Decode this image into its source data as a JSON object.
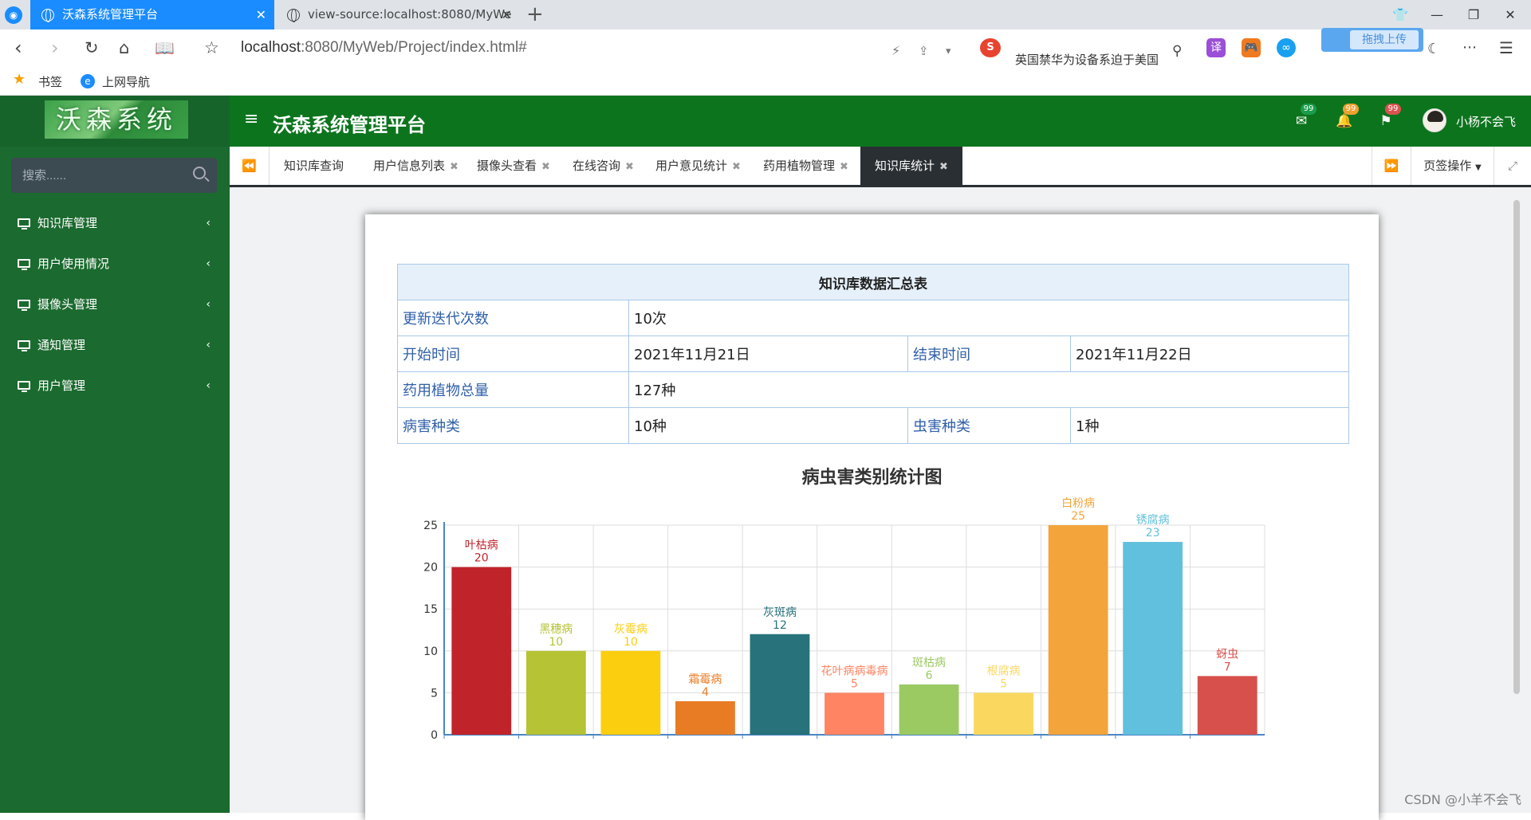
{
  "browser": {
    "tabs": [
      {
        "title": "沃森系统管理平台",
        "active": true
      },
      {
        "title": "view-source:localhost:8080/MyWe",
        "active": false
      }
    ],
    "url_host": "localhost",
    "url_path": ":8080/MyWeb/Project/index.html#",
    "headline": "英国禁华为设备系迫于美国",
    "upload_label": "拖拽上传",
    "bookmarks": [
      "书签",
      "上网导航"
    ],
    "extension_label": "译"
  },
  "app": {
    "logo_text": "沃森系统",
    "title": "沃森系统管理平台",
    "search_placeholder": "搜索......",
    "menu": [
      {
        "label": "知识库管理"
      },
      {
        "label": "用户使用情况"
      },
      {
        "label": "摄像头管理"
      },
      {
        "label": "通知管理"
      },
      {
        "label": "用户管理"
      }
    ],
    "badges": [
      {
        "icon": "mail-icon",
        "count": "99",
        "color": "#1c9c4c"
      },
      {
        "icon": "bell-icon",
        "count": "99",
        "color": "#f0a030"
      },
      {
        "icon": "flag-icon",
        "count": "99",
        "color": "#d9534f"
      }
    ],
    "user_name": "小杨不会飞",
    "page_tabs": [
      {
        "label": "知识库查询",
        "closable": false,
        "active": false
      },
      {
        "label": "用户信息列表",
        "closable": true,
        "active": false
      },
      {
        "label": "摄像头查看",
        "closable": true,
        "active": false
      },
      {
        "label": "在线咨询",
        "closable": true,
        "active": false
      },
      {
        "label": "用户意见统计",
        "closable": true,
        "active": false
      },
      {
        "label": "药用植物管理",
        "closable": true,
        "active": false
      },
      {
        "label": "知识库统计",
        "closable": true,
        "active": true
      }
    ],
    "page_ops_label": "页签操作"
  },
  "summary": {
    "title": "知识库数据汇总表",
    "iterations_label": "更新迭代次数",
    "iterations": "10次",
    "start_label": "开始时间",
    "start": "2021年11月21日",
    "end_label": "结束时间",
    "end": "2021年11月22日",
    "plants_label": "药用植物总量",
    "plants": "127种",
    "disease_label": "病害种类",
    "disease": "10种",
    "pest_label": "虫害种类",
    "pest": "1种"
  },
  "chart_data": {
    "type": "bar",
    "title": "病虫害类别统计图",
    "categories": [
      "叶枯病",
      "黑穗病",
      "灰霉病",
      "霜霉病",
      "灰斑病",
      "花叶病病毒病",
      "斑枯病",
      "根腐病",
      "白粉病",
      "锈腐病",
      "蚜虫"
    ],
    "values": [
      20,
      10,
      10,
      4,
      12,
      5,
      6,
      5,
      25,
      23,
      7
    ],
    "colors": [
      "#c1232b",
      "#b5c334",
      "#fcce10",
      "#e87c25",
      "#27727b",
      "#fe8463",
      "#9bca63",
      "#fad860",
      "#f3a43b",
      "#60c0dd",
      "#d7504b"
    ],
    "ylim": [
      0,
      25
    ],
    "yticks": [
      0,
      5,
      10,
      15,
      20,
      25
    ],
    "grid": true,
    "xlabel": "",
    "ylabel": ""
  },
  "watermark": "CSDN @小羊不会飞"
}
